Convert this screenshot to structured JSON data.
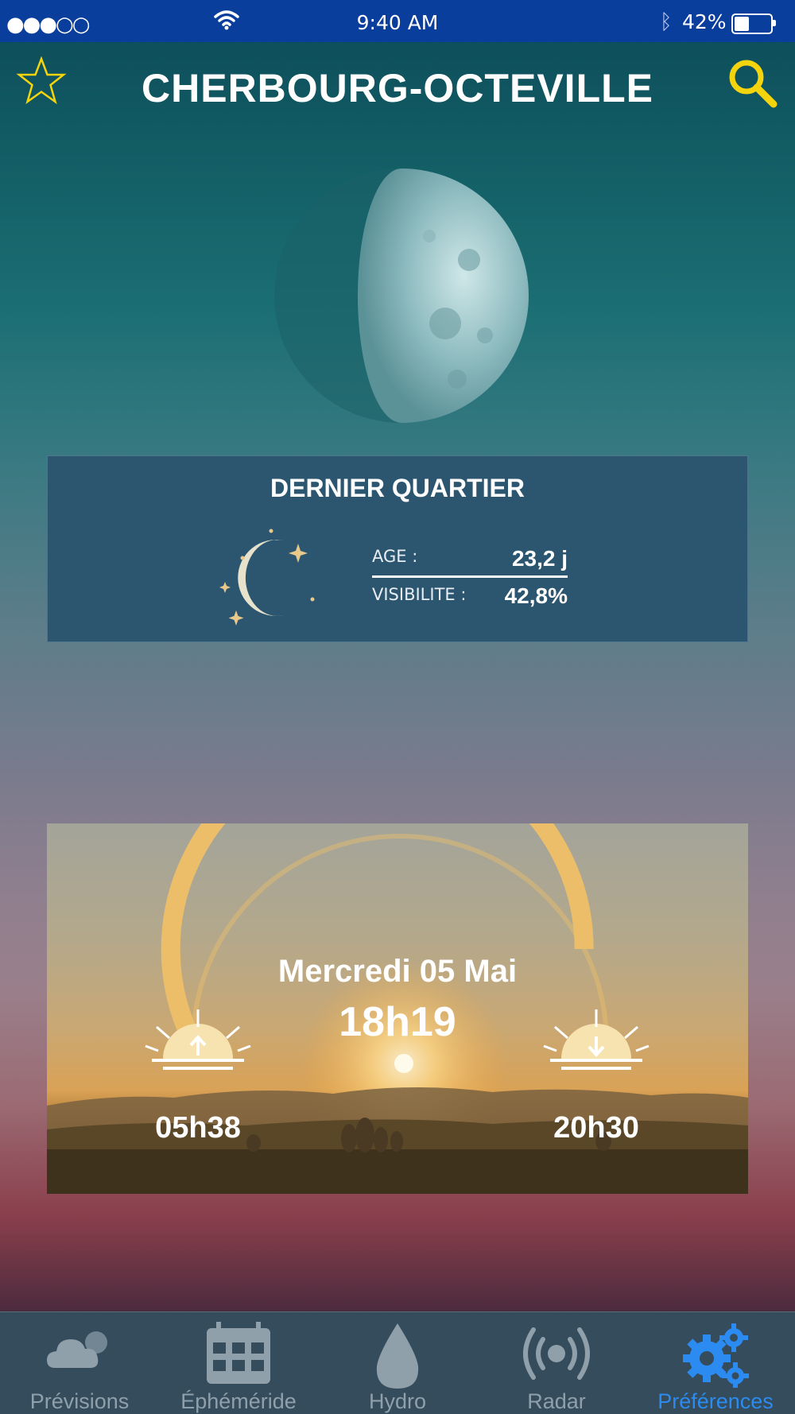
{
  "status_bar": {
    "signal": "●●●○○",
    "time": "9:40 AM",
    "battery_percent": "42%",
    "battery_level": 0.42
  },
  "header": {
    "city": "CHERBOURG-OCTEVILLE",
    "favorite_icon": "star-icon",
    "search_icon": "search-icon"
  },
  "moon_phase": {
    "title": "DERNIER QUARTIER",
    "age_label": "AGE :",
    "age_value": "23,2 j",
    "visibility_label": "VISIBILITE :",
    "visibility_value": "42,8%"
  },
  "sun": {
    "date": "Mercredi 05 Mai",
    "current_time": "18h19",
    "sunrise": "05h38",
    "sunset": "20h30",
    "day_progress": 0.85
  },
  "tabs": [
    {
      "label": "Prévisions",
      "icon": "cloud-icon",
      "active": false
    },
    {
      "label": "Éphéméride",
      "icon": "calendar-icon",
      "active": false
    },
    {
      "label": "Hydro",
      "icon": "drop-icon",
      "active": false
    },
    {
      "label": "Radar",
      "icon": "radar-icon",
      "active": false
    },
    {
      "label": "Préférences",
      "icon": "gears-icon",
      "active": true
    }
  ],
  "colors": {
    "status_bar": "#0a3e9c",
    "accent_yellow": "#f4d40c",
    "card_blue": "#2c5670",
    "sun_arc": "#ecbe6a",
    "tab_active": "#2b8bf0",
    "tab_inactive": "#8fa0ab"
  }
}
